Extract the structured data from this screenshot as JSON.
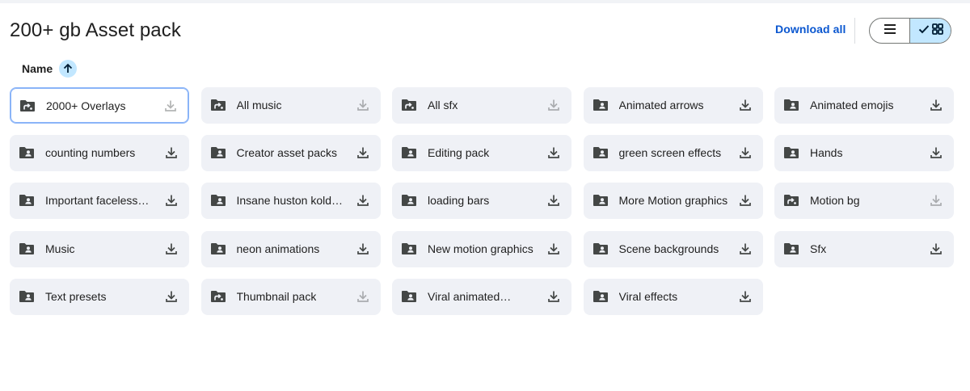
{
  "header": {
    "title": "200+ gb Asset pack",
    "download_all_label": "Download all"
  },
  "view_toggle": {
    "selected": "grid",
    "list_icon": "list-icon",
    "grid_icon": "grid-icon",
    "check_icon": "check-icon"
  },
  "sort": {
    "label": "Name",
    "direction": "ascending",
    "arrow_icon": "arrow-up-icon"
  },
  "colors": {
    "accent": "#0b57d0",
    "card_bg": "#eff1f6",
    "toggle_selected_bg": "#c2e7ff"
  },
  "items": [
    {
      "name": "2000+ Overlays",
      "type": "shortcut-folder",
      "download_enabled": false,
      "selected": true
    },
    {
      "name": "All music",
      "type": "shortcut-folder",
      "download_enabled": false
    },
    {
      "name": "All sfx",
      "type": "shortcut-folder",
      "download_enabled": false
    },
    {
      "name": "Animated arrows",
      "type": "shared-folder",
      "download_enabled": true
    },
    {
      "name": "Animated emojis",
      "type": "shared-folder",
      "download_enabled": true
    },
    {
      "name": "counting numbers",
      "type": "shared-folder",
      "download_enabled": true
    },
    {
      "name": "Creator asset packs",
      "type": "shared-folder",
      "download_enabled": true
    },
    {
      "name": "Editing pack",
      "type": "shared-folder",
      "download_enabled": true
    },
    {
      "name": "green screen effects",
      "type": "shared-folder",
      "download_enabled": true
    },
    {
      "name": "Hands",
      "type": "shared-folder",
      "download_enabled": true
    },
    {
      "name": "Important faceless…",
      "type": "shared-folder",
      "download_enabled": true
    },
    {
      "name": "Insane huston kold…",
      "type": "shared-folder",
      "download_enabled": true
    },
    {
      "name": "loading bars",
      "type": "shared-folder",
      "download_enabled": true
    },
    {
      "name": "More Motion graphics",
      "type": "shared-folder",
      "download_enabled": true
    },
    {
      "name": "Motion bg",
      "type": "shortcut-folder",
      "download_enabled": false
    },
    {
      "name": "Music",
      "type": "shared-folder",
      "download_enabled": true
    },
    {
      "name": "neon animations",
      "type": "shared-folder",
      "download_enabled": true
    },
    {
      "name": "New motion graphics",
      "type": "shared-folder",
      "download_enabled": true
    },
    {
      "name": "Scene backgrounds",
      "type": "shared-folder",
      "download_enabled": true
    },
    {
      "name": "Sfx",
      "type": "shared-folder",
      "download_enabled": true
    },
    {
      "name": "Text presets",
      "type": "shared-folder",
      "download_enabled": true
    },
    {
      "name": "Thumbnail pack",
      "type": "shortcut-folder",
      "download_enabled": false
    },
    {
      "name": "Viral animated…",
      "type": "shared-folder",
      "download_enabled": true
    },
    {
      "name": "Viral effects",
      "type": "shared-folder",
      "download_enabled": true
    }
  ]
}
